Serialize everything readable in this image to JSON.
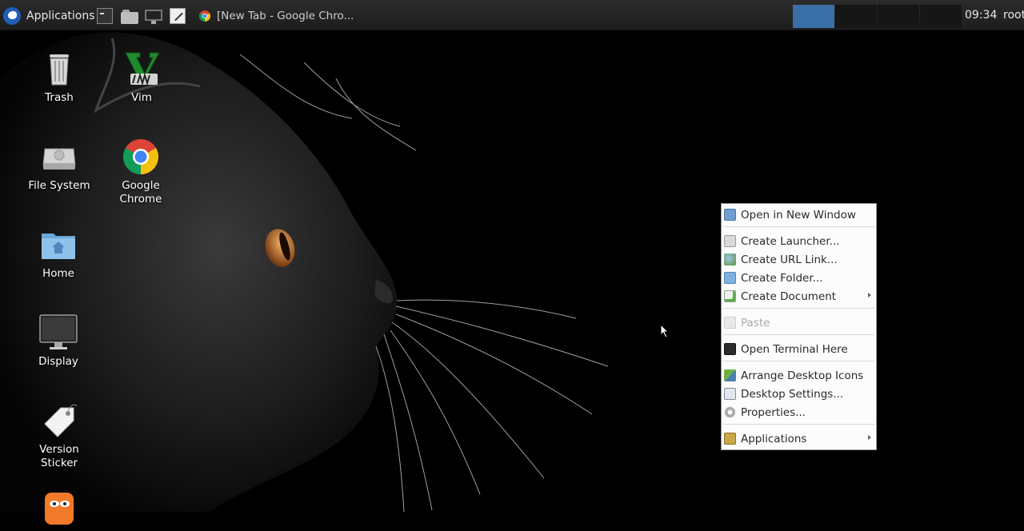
{
  "panel": {
    "applications_label": "Applications",
    "launchers": [
      "terminal-icon",
      "home-folder-icon",
      "display-icon",
      "text-editor-icon"
    ],
    "task_title": "[New Tab - Google Chro...",
    "workspaces": [
      {
        "name": "workspace-1",
        "active": true
      },
      {
        "name": "workspace-2",
        "active": false
      },
      {
        "name": "workspace-3",
        "active": false
      },
      {
        "name": "workspace-4",
        "active": false
      }
    ],
    "clock": "09:34",
    "user": "root"
  },
  "desktop": {
    "icons": [
      {
        "id": "trash",
        "label": "Trash"
      },
      {
        "id": "vim",
        "label": "Vim"
      },
      {
        "id": "filesystem",
        "label": "File System"
      },
      {
        "id": "chrome",
        "label_line1": "Google",
        "label_line2": "Chrome"
      },
      {
        "id": "home",
        "label": "Home"
      },
      {
        "id": "display",
        "label": "Display"
      },
      {
        "id": "sticker",
        "label_line1": "Version",
        "label_line2": "Sticker"
      }
    ]
  },
  "menu": {
    "items": [
      {
        "label": "Open in New Window",
        "icon": "window-icon"
      },
      {
        "label": "Create Launcher...",
        "icon": "launcher-icon"
      },
      {
        "label": "Create URL Link...",
        "icon": "link-icon"
      },
      {
        "label": "Create Folder...",
        "icon": "folder-add-icon"
      },
      {
        "label": "Create Document",
        "icon": "document-add-icon",
        "submenu": true
      },
      {
        "label": "Paste",
        "icon": "paste-icon",
        "disabled": true
      },
      {
        "label": "Open Terminal Here",
        "icon": "terminal-icon"
      },
      {
        "label": "Arrange Desktop Icons",
        "icon": "sort-icon"
      },
      {
        "label": "Desktop Settings...",
        "icon": "settings-icon"
      },
      {
        "label": "Properties...",
        "icon": "gear-icon"
      },
      {
        "label": "Applications",
        "icon": "applications-icon",
        "submenu": true
      }
    ]
  },
  "colors": {
    "panel_bg": "#232323",
    "workspace_active": "#3a6ea6",
    "menu_bg": "#fcfcfc",
    "disabled_text": "#a8a8a8"
  }
}
